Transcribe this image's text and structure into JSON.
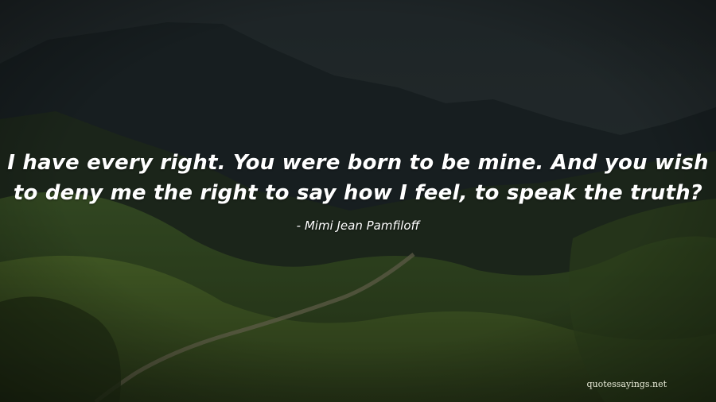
{
  "quote": {
    "line1": "I have every right. You were born to be mine. And you wish",
    "line2": "to deny me the right to say how I feel, to speak the truth?"
  },
  "author": "- Mimi Jean Pamfiloff",
  "watermark": "quotessayings.net",
  "colors": {
    "sky": "#2c3538",
    "mountains": "#1b2224",
    "hills": "#3f5a1f",
    "text": "#ffffff"
  }
}
